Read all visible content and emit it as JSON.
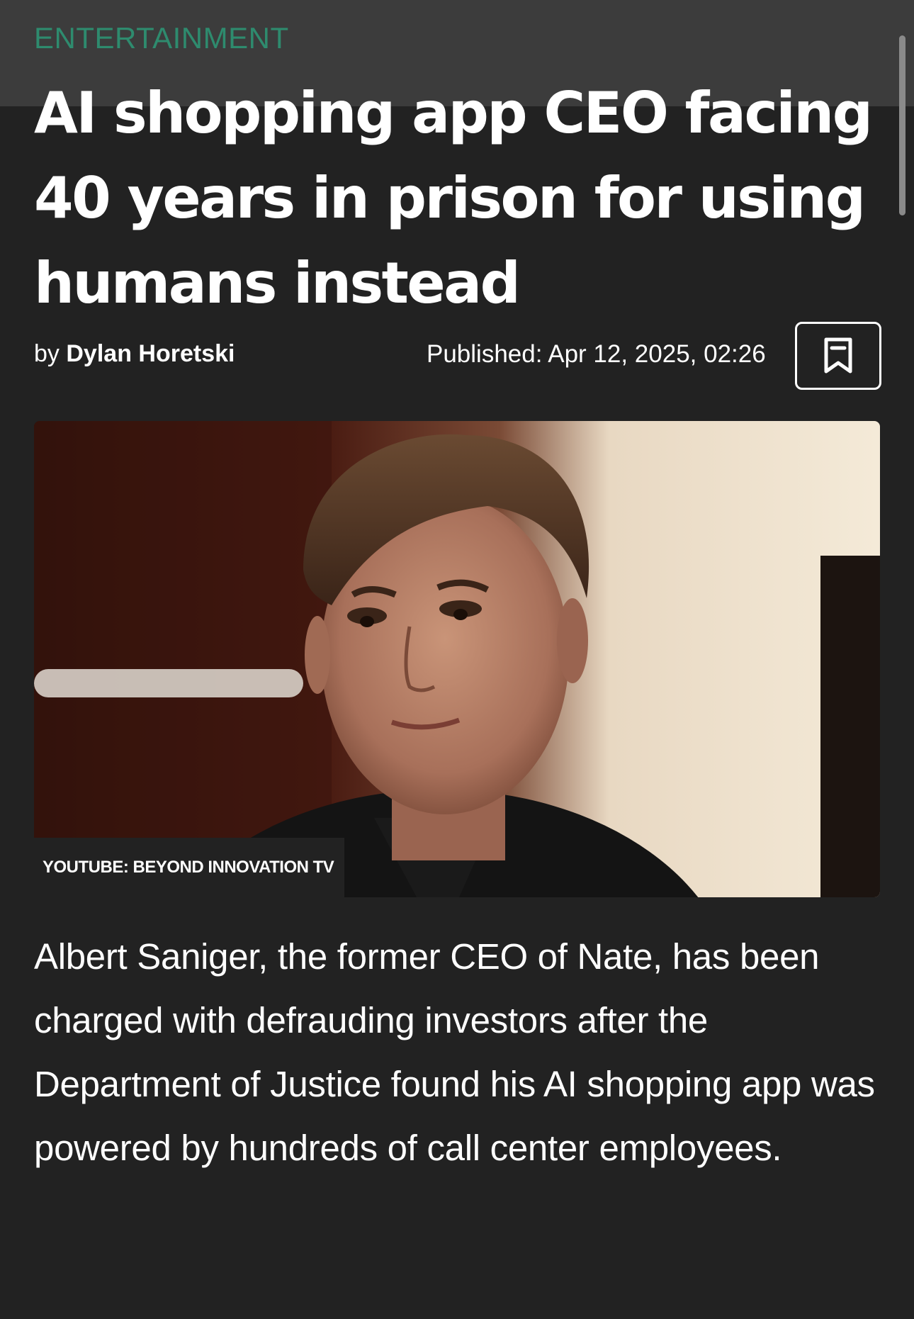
{
  "article": {
    "category": "ENTERTAINMENT",
    "headline": "AI shopping app CEO facing 40 years in prison for using humans instead",
    "byline_prefix": "by",
    "author": "Dylan Horetski",
    "published": "Published: Apr 12, 2025, 02:26",
    "bookmark_icon": "bookmark-icon",
    "image": {
      "description_icon": "portrait-photo",
      "credit": "YOUTUBE: BEYOND INNOVATION TV"
    },
    "lede": "Albert Saniger, the former CEO of Nate, has been charged with defrauding investors after the Department of Justice found his AI shopping app was powered by hundreds of call center employees."
  },
  "colors": {
    "background": "#222222",
    "category": "#2e8b6e",
    "text": "#ffffff"
  }
}
